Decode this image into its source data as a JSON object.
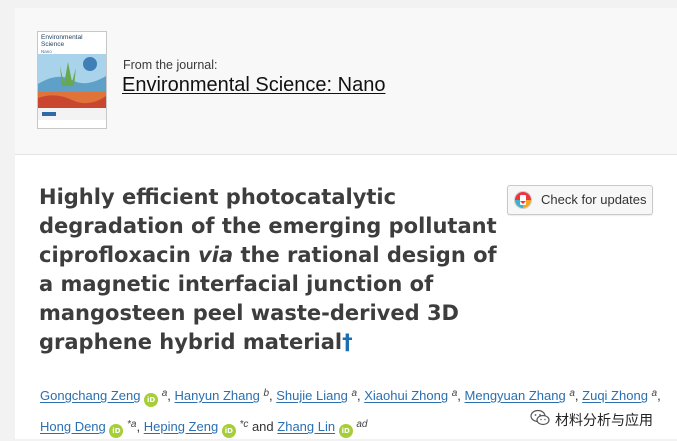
{
  "journal": {
    "from_label": "From the journal:",
    "name": "Environmental Science: Nano",
    "cover_title": "Environmental Science",
    "cover_subtitle": "Nano"
  },
  "article": {
    "title_part1": "Highly efficient photocatalytic degradation of the emerging pollutant ciprofloxacin ",
    "title_italic": "via",
    "title_part2": " the rational design of a magnetic interfacial junction of mangosteen peel waste-derived 3D graphene hybrid material",
    "title_dagger": "†"
  },
  "check_updates": {
    "label": "Check for updates"
  },
  "orcid_icon": "orcid-id-icon",
  "authors": [
    {
      "name": "Gongchang Zeng",
      "orcid": true,
      "aff": "a",
      "sep": ","
    },
    {
      "name": "Hanyun Zhang",
      "orcid": false,
      "aff": "b",
      "sep": ","
    },
    {
      "name": "Shujie Liang",
      "orcid": false,
      "aff": "a",
      "sep": ","
    },
    {
      "name": "Xiaohui Zhong",
      "orcid": false,
      "aff": "a",
      "sep": ","
    },
    {
      "name": "Mengyuan Zhang",
      "orcid": false,
      "aff": "a",
      "sep": ","
    },
    {
      "name": "Zuqi Zhong",
      "orcid": false,
      "aff": "a",
      "sep": ","
    },
    {
      "name": "Hong Deng",
      "orcid": true,
      "aff": "*a",
      "sep": ","
    },
    {
      "name": "Heping Zeng",
      "orcid": true,
      "aff": "*c",
      "sep": " and"
    },
    {
      "name": "Zhang Lin",
      "orcid": true,
      "aff": "ad",
      "sep": ""
    }
  ],
  "watermark": {
    "text": "材料分析与应用",
    "icon": "wechat-icon"
  }
}
